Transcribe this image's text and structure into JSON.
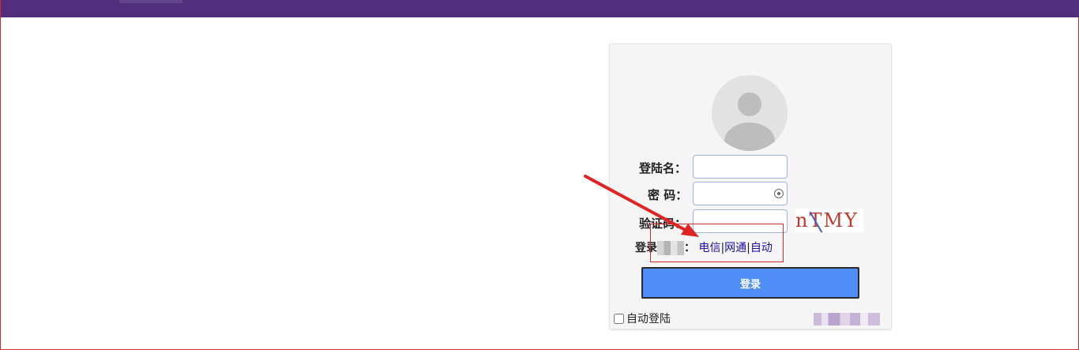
{
  "login_form": {
    "username_label": "登陆名：",
    "username_value": "",
    "password_label": "密 码：",
    "password_value": "",
    "captcha_label": "验证码：",
    "captcha_value": "",
    "captcha_image_text": "nTMY",
    "login_type": {
      "label_prefix": "登录",
      "label_suffix": "：",
      "options": [
        "电信",
        "网通",
        "自动"
      ],
      "separator": "|"
    },
    "submit_label": "登录",
    "auto_login_label": "自动登陆",
    "auto_login_checked": false
  },
  "colors": {
    "top_bar": "#522f7d",
    "button": "#4f8ef7",
    "annotation": "#d42a2a",
    "link": "#1a0dab"
  },
  "icons": {
    "avatar": "user-avatar-icon",
    "password_reveal": "eye-icon"
  }
}
